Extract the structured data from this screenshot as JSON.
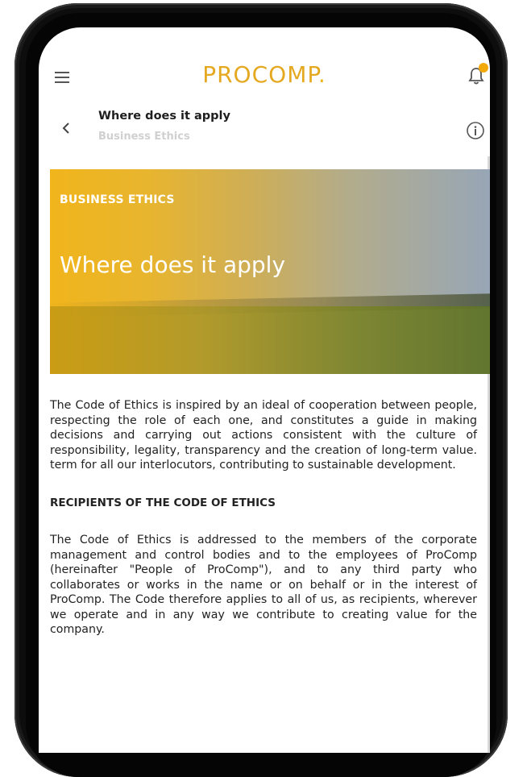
{
  "app": {
    "logo_text": "PROCOMP",
    "logo_dot": "."
  },
  "header": {
    "title": "Where does it apply",
    "subtitle": "Business Ethics"
  },
  "hero": {
    "kicker": "BUSINESS ETHICS",
    "title": "Where does it apply"
  },
  "content": {
    "intro": "The Code of Ethics is inspired by an ideal of cooperation between people, respecting the role of each one, and constitutes a guide in making decisions and carrying out actions consistent with the culture of responsibility, legality, transparency and the creation of long-term value. term for all our interlocutors, contributing to sustainable development.",
    "section_heading": "RECIPIENTS OF THE CODE OF ETHICS",
    "section_text": "The Code of Ethics is addressed to the members of the corporate management and control bodies and to the employees of ProComp (hereinafter \"People of ProComp\"), and to any third party who collaborates or works in the name or on behalf or in the interest of ProComp. The Code therefore applies to all of us, as recipients, wherever we operate and in any way we contribute to creating value for the company."
  },
  "icons": {
    "menu": "menu-icon",
    "notifications": "bell-icon",
    "back": "chevron-left-icon",
    "info": "info-icon"
  },
  "colors": {
    "brand": "#e5a821",
    "badge": "#f4a90b",
    "text": "#222222"
  }
}
